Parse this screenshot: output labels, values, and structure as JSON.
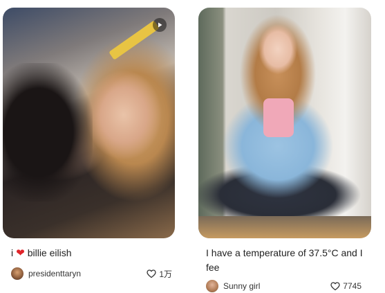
{
  "cards": [
    {
      "title_prefix": "i",
      "title_heart": "❤",
      "title_suffix": "billie eilish",
      "author": "presidenttaryn",
      "likes": "1万",
      "has_play_badge": true
    },
    {
      "title": "I have a temperature of 37.5°C and I fee",
      "author": "Sunny girl",
      "likes": "7745"
    }
  ],
  "icons": {
    "play": "play-icon",
    "heart": "heart-outline-icon",
    "red_heart": "red-heart-emoji"
  },
  "colors": {
    "heart_red": "#e0242a",
    "text": "#222222"
  }
}
